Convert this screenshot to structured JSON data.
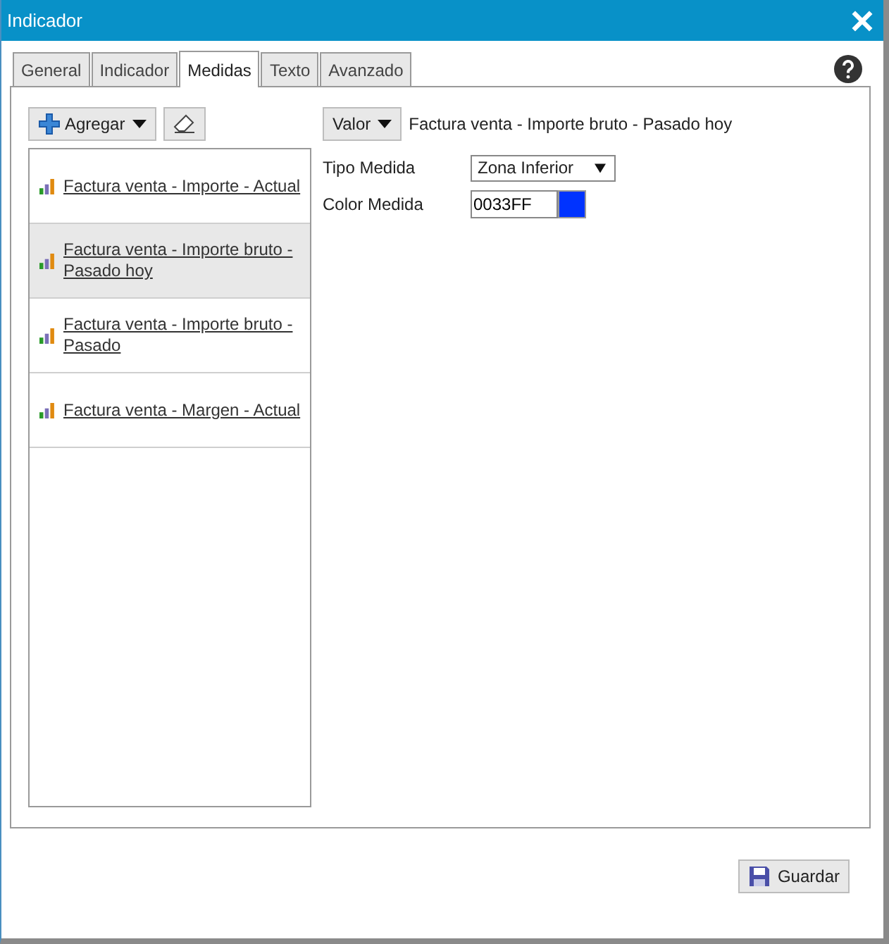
{
  "window": {
    "title": "Indicador"
  },
  "tabs": [
    {
      "label": "General",
      "selected": false
    },
    {
      "label": "Indicador",
      "selected": false
    },
    {
      "label": "Medidas",
      "selected": true
    },
    {
      "label": "Texto",
      "selected": false
    },
    {
      "label": "Avanzado",
      "selected": false
    }
  ],
  "toolbar": {
    "add_button": "Agregar"
  },
  "measures": [
    {
      "label": "Factura venta - Importe - Actual",
      "selected": false
    },
    {
      "label": "Factura venta - Importe bruto - Pasado hoy",
      "selected": true
    },
    {
      "label": "Factura venta - Importe bruto - Pasado",
      "selected": false
    },
    {
      "label": "Factura venta - Margen - Actual",
      "selected": false
    }
  ],
  "detail": {
    "value_button": "Valor",
    "measure_name": "Factura venta - Importe bruto - Pasado hoy",
    "fields": [
      {
        "kind": "select",
        "label": "Tipo Medida",
        "value": "Zona Inferior"
      },
      {
        "kind": "color",
        "label": "Color Medida",
        "value": "0033FF",
        "color": "#0033ff"
      }
    ]
  },
  "save_button": "Guardar"
}
